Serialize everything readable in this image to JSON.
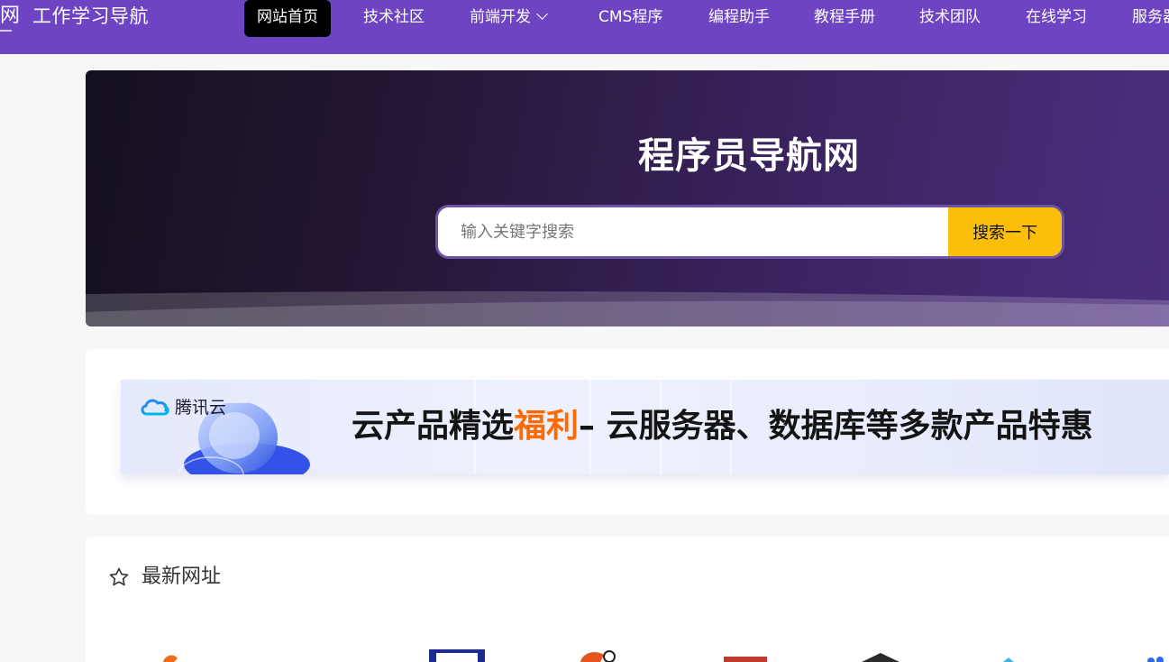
{
  "header": {
    "logo_glyph": "网",
    "site_name": "工作学习导航",
    "nav": [
      {
        "label": "网站首页"
      },
      {
        "label": "技术社区"
      },
      {
        "label": "前端开发"
      },
      {
        "label": "CMS程序"
      },
      {
        "label": "编程助手"
      },
      {
        "label": "教程手册"
      },
      {
        "label": "技术团队"
      },
      {
        "label": "在线学习"
      },
      {
        "label": "服务器"
      }
    ],
    "active_index": 0
  },
  "hero": {
    "title": "程序员导航网",
    "search_placeholder": "输入关键字搜索",
    "search_value": "",
    "search_button": "搜索一下"
  },
  "ad_banner": {
    "brand": "腾讯云",
    "text_before": "云产品精选",
    "text_highlight": "福利",
    "text_after": "– 云服务器、数据库等多款产品特惠"
  },
  "latest": {
    "title": "最新网址"
  },
  "colors": {
    "header_bg": "#6e44c2",
    "active_nav_bg": "#000000",
    "search_button_bg": "#fbbf0b",
    "ad_highlight": "#ff6a00"
  },
  "icons": [
    "star-icon",
    "chevron-down-icon",
    "tencent-cloud-logo"
  ]
}
